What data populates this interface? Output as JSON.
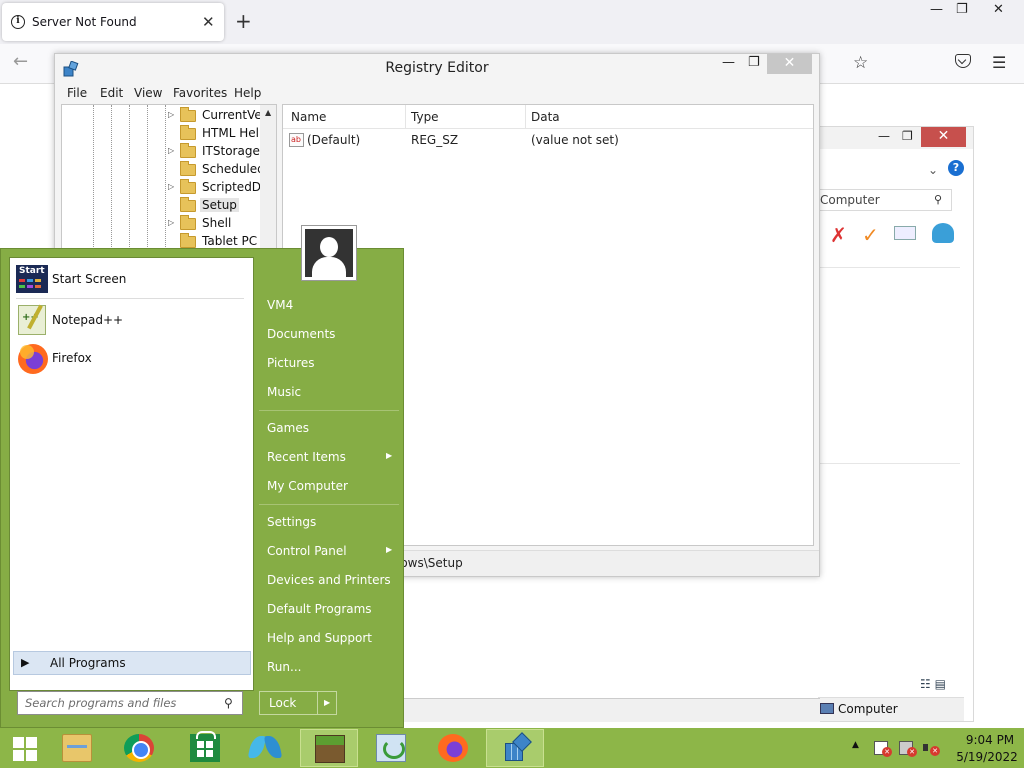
{
  "browser": {
    "tab_title": "Server Not Found",
    "close_glyph": "✕",
    "newtab_glyph": "+",
    "minimize_glyph": "—",
    "maximize_glyph": "❐",
    "close_window_glyph": "✕",
    "back_glyph": "←",
    "star_glyph": "☆",
    "menu_glyph": "☰"
  },
  "explorer_bg": {
    "search_placeholder": "Computer",
    "search_icon": "⚲",
    "help_glyph": "?",
    "chevron_glyph": "⌄",
    "status_item": "Computer",
    "view_icons": "☷ ▤"
  },
  "regedit": {
    "title": "Registry Editor",
    "menu": [
      "File",
      "Edit",
      "View",
      "Favorites",
      "Help"
    ],
    "tree_items": [
      {
        "label": "CurrentVer",
        "expandable": true
      },
      {
        "label": "HTML Help",
        "expandable": false
      },
      {
        "label": "ITStorage",
        "expandable": true
      },
      {
        "label": "ScheduledI",
        "expandable": false
      },
      {
        "label": "ScriptedDia",
        "expandable": true
      },
      {
        "label": "Setup",
        "expandable": false,
        "selected": true
      },
      {
        "label": "Shell",
        "expandable": true
      },
      {
        "label": "Tablet PC",
        "expandable": false
      }
    ],
    "columns": [
      "Name",
      "Type",
      "Data"
    ],
    "values": [
      {
        "name": "(Default)",
        "type": "REG_SZ",
        "data": "(value not set)"
      }
    ],
    "statusbar": "lows\\Setup"
  },
  "startmenu": {
    "pinned": [
      {
        "label": "Start Screen",
        "icon": "start-screen-icon"
      },
      {
        "label": "Notepad++",
        "icon": "notepad-plus-plus-icon"
      },
      {
        "label": "Firefox",
        "icon": "firefox-icon"
      }
    ],
    "all_programs": "All Programs",
    "search_placeholder": "Search programs and files",
    "right_items": [
      {
        "label": "VM4",
        "submenu": false
      },
      {
        "label": "Documents",
        "submenu": false
      },
      {
        "label": "Pictures",
        "submenu": false
      },
      {
        "label": "Music",
        "submenu": false
      },
      {
        "label": "Games",
        "submenu": false
      },
      {
        "label": "Recent Items",
        "submenu": true
      },
      {
        "label": "My Computer",
        "submenu": false
      },
      {
        "label": "Settings",
        "submenu": false
      },
      {
        "label": "Control Panel",
        "submenu": true
      },
      {
        "label": "Devices and Printers",
        "submenu": false
      },
      {
        "label": "Default Programs",
        "submenu": false
      },
      {
        "label": "Help and Support",
        "submenu": false
      },
      {
        "label": "Run...",
        "submenu": false
      }
    ],
    "lock_label": "Lock",
    "start_icon_text": "Start"
  },
  "taskbar": {
    "apps": [
      "file-explorer-icon",
      "chrome-icon",
      "store-icon",
      "butterfly-app-icon",
      "minecraft-icon",
      "sync-app-icon",
      "firefox-icon",
      "regedit-icon"
    ],
    "time": "9:04 PM",
    "date": "5/19/2022"
  },
  "colors": {
    "accent_green": "#86ad45",
    "taskbar_green": "#8db648",
    "close_red": "#c7504d"
  }
}
